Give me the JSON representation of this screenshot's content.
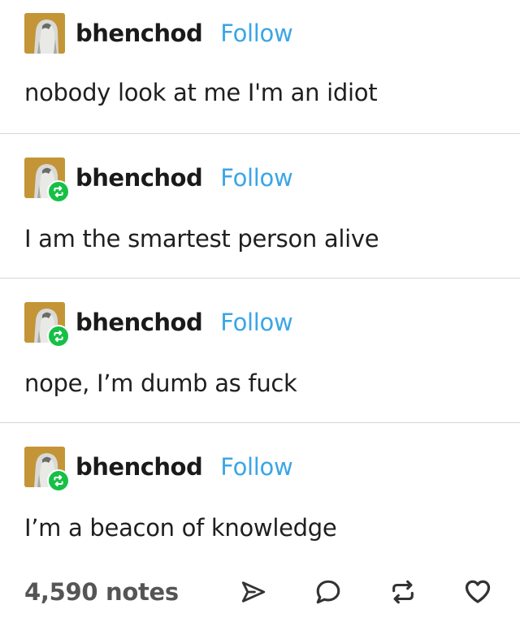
{
  "posts": [
    {
      "username": "bhenchod",
      "follow_label": "Follow",
      "text": "nobody look at me I'm an idiot",
      "reblog": false
    },
    {
      "username": "bhenchod",
      "follow_label": "Follow",
      "text": "I am the smartest person alive",
      "reblog": true
    },
    {
      "username": "bhenchod",
      "follow_label": "Follow",
      "text": "nope, I’m dumb as fuck",
      "reblog": true
    },
    {
      "username": "bhenchod",
      "follow_label": "Follow",
      "text": "I’m a beacon of knowledge",
      "reblog": true
    }
  ],
  "footer": {
    "notes": "4,590 notes",
    "icons": [
      "share-icon",
      "reply-icon",
      "reblog-icon",
      "like-icon"
    ]
  },
  "colors": {
    "follow": "#3aa6e6",
    "reblog_badge": "#16c046",
    "avatar_bg": "#c79a3a"
  }
}
